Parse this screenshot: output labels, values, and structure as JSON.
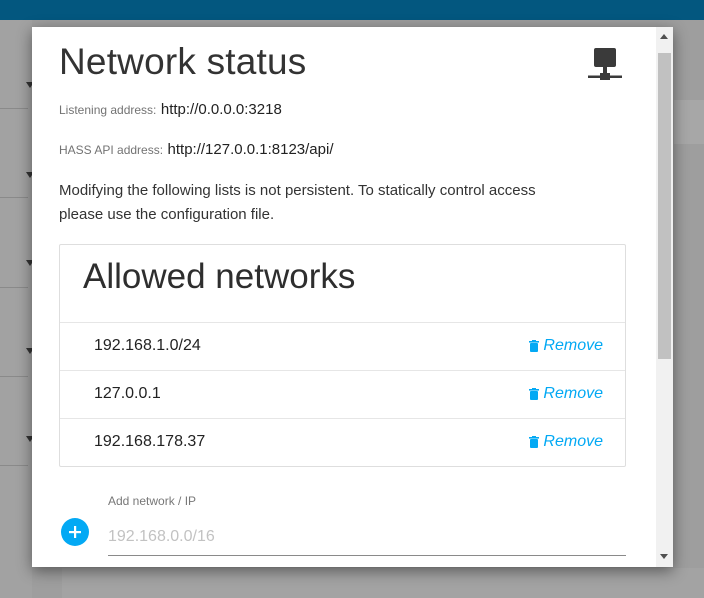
{
  "dialog": {
    "title": "Network status",
    "listening_label": "Listening address:",
    "listening_value": "http://0.0.0.0:3218",
    "api_label": "HASS API address:",
    "api_value": "http://127.0.0.1:8123/api/",
    "note_line1": "Modifying the following lists is not persistent. To statically control access",
    "note_line2": "please use the configuration file.",
    "icon": "network-icon"
  },
  "allowed": {
    "title": "Allowed networks",
    "remove_label": "Remove",
    "items": [
      {
        "ip": "192.168.1.0/24"
      },
      {
        "ip": "127.0.0.1"
      },
      {
        "ip": "192.168.178.37"
      }
    ]
  },
  "add": {
    "label": "Add network / IP",
    "placeholder": "192.168.0.0/16",
    "icon": "plus-circle-icon"
  },
  "colors": {
    "accent": "#03a9f4",
    "topbar": "#03577f"
  }
}
